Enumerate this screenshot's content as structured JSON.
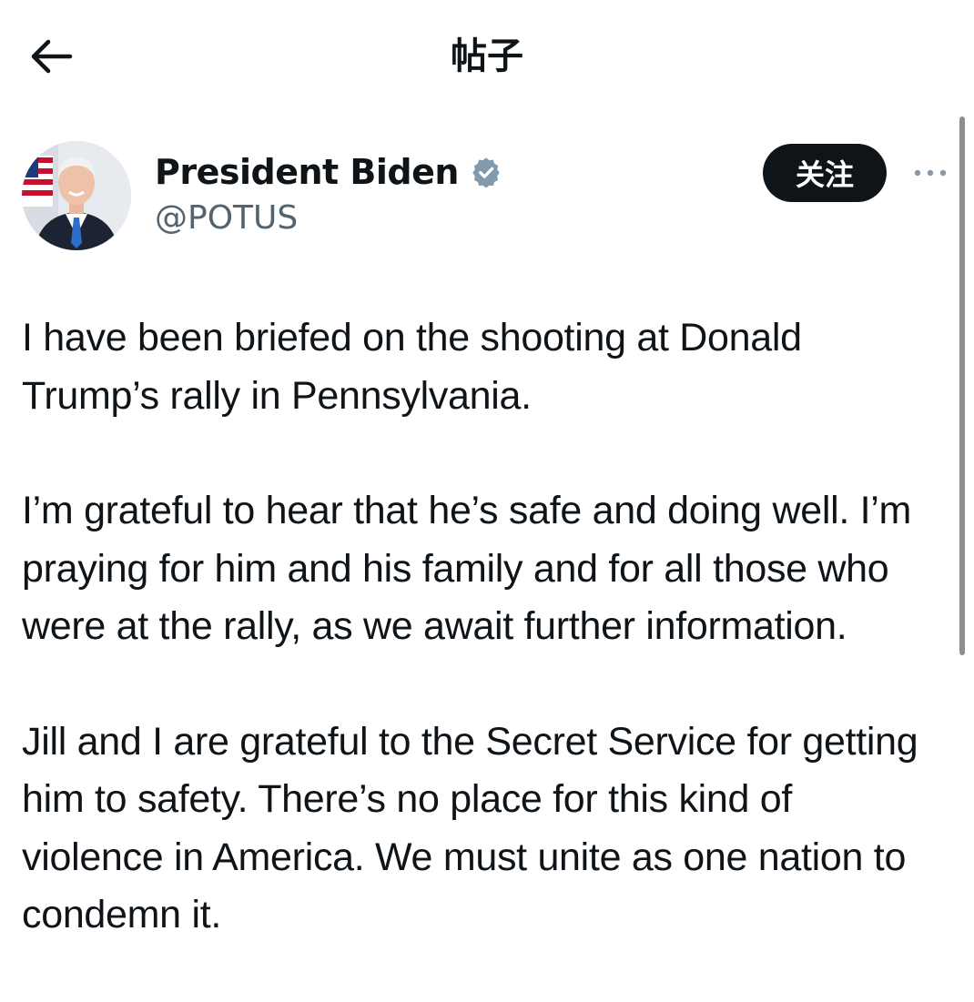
{
  "header": {
    "title": "帖子",
    "back_icon": "arrow-left-icon"
  },
  "author": {
    "name": "President Biden",
    "handle": "@POTUS",
    "verified_icon": "verified-badge-icon",
    "verified_color": "#829aab"
  },
  "actions": {
    "follow_label": "关注",
    "more_icon": "more-horizontal-icon"
  },
  "post": {
    "paragraphs": [
      "I have been briefed on the shooting at Donald Trump’s rally in Pennsylvania.",
      "I’m grateful to hear that he’s safe and doing well. I’m praying for him and his family and for all those who were at the rally, as we await further information.",
      "Jill and I are grateful to the Secret Service for getting him to safety. There’s no place for this kind of violence in America. We must unite as one nation to condemn it."
    ]
  },
  "colors": {
    "text": "#0f1419",
    "secondary_text": "#536471",
    "follow_button_bg": "#0f1419",
    "follow_button_text": "#ffffff"
  }
}
